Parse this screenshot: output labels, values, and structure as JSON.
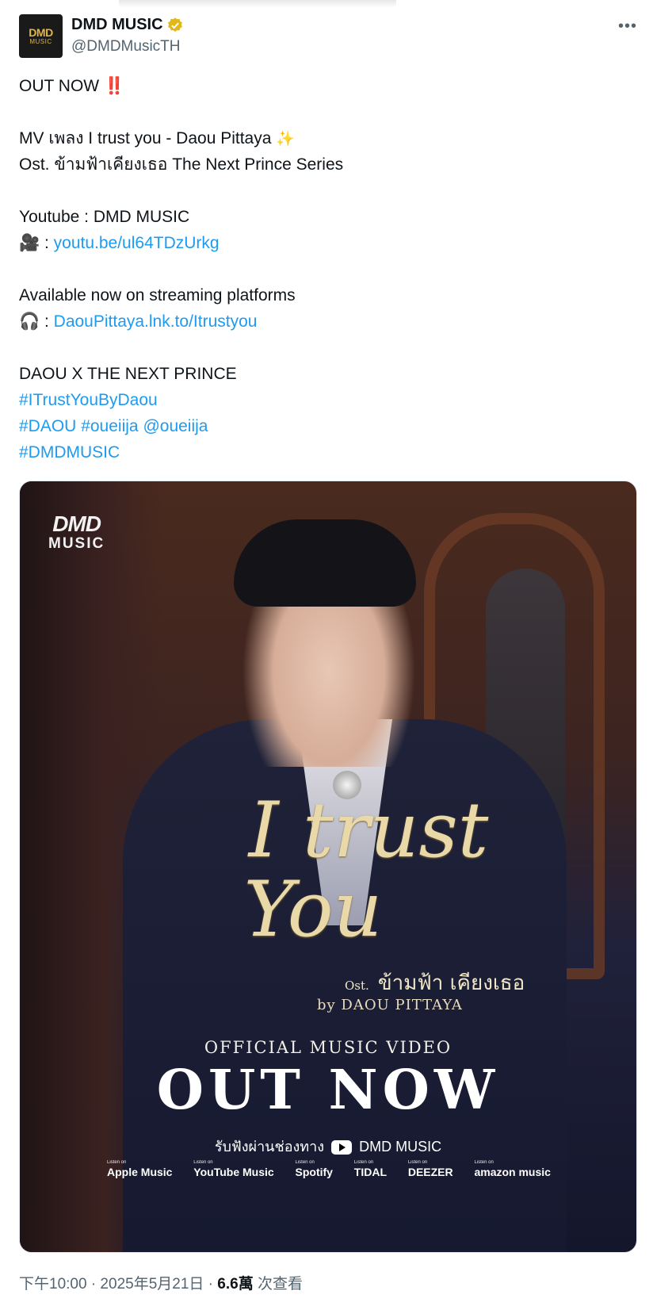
{
  "account": {
    "name": "DMD MUSIC",
    "handle": "@DMDMusicTH",
    "avatar_line1": "DMD",
    "avatar_line2": "MUSIC",
    "verified_color": "#e2b719"
  },
  "menu": {
    "more_label": "•••"
  },
  "tweet": {
    "line1": "OUT NOW ",
    "line1_emoji": "‼️",
    "line2": "MV เพลง I trust you - Daou Pittaya ",
    "line2_emoji": "✨",
    "line3": "Ost. ข้ามฟ้าเคียงเธอ The Next Prince Series",
    "line4": "Youtube : DMD MUSIC",
    "line5_prefix": "🎥 : ",
    "line5_link": "youtu.be/ul64TDzUrkg",
    "line6": "Available now on streaming platforms",
    "line7_prefix": "🎧 : ",
    "line7_link": "DaouPittaya.lnk.to/Itrustyou",
    "line8": "DAOU X THE NEXT PRINCE",
    "hashtag1": "#ITrustYouByDaou",
    "hashtag2": "#DAOU",
    "hashtag3": "#oueiija",
    "mention1": "@oueiija",
    "hashtag4": "#DMDMUSIC"
  },
  "poster": {
    "logo_line1": "DMD",
    "logo_line2": "MUSIC",
    "script_line1": "I trust",
    "script_line2": "You",
    "ost_prefix": "Ost.",
    "ost_title": "ข้ามฟ้า เคียงเธอ",
    "byline": "by DAOU PITTAYA",
    "official": "OFFICIAL MUSIC VIDEO",
    "out_now": "OUT NOW",
    "listen_text": "รับฟังผ่านช่องทาง",
    "listen_channel": "DMD MUSIC",
    "listen_on": "Listen on",
    "platforms": [
      "Apple Music",
      "YouTube Music",
      "Spotify",
      "TIDAL",
      "DEEZER",
      "amazon music"
    ]
  },
  "footer": {
    "time": "下午10:00 · 2025年5月21日 · ",
    "views": "6.6萬",
    "views_label": " 次查看"
  },
  "colors": {
    "link": "#1d9bf0",
    "text": "#0f1419",
    "muted": "#536471"
  }
}
